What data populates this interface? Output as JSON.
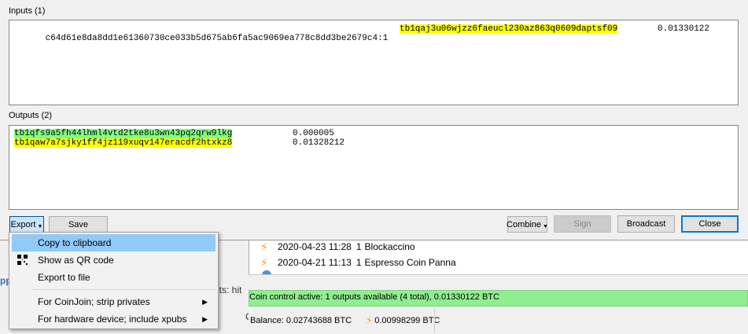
{
  "dialog": {
    "inputs_label": "Inputs (1)",
    "outputs_label": "Outputs (2)",
    "inputs": [
      {
        "outpoint": "c64d61e8da8dd1e61360730ce033b5d675ab6fa5ac9069ea778c8dd3be2679c4:1",
        "address": "tb1qaj3u06wjzz6faeucl230az863q0609daptsf09",
        "amount": "0.01330122",
        "highlight": "#ffff00"
      }
    ],
    "outputs": [
      {
        "address": "tb1qfs9a5fh44lhml4vtd2tke8u3wn43pq2qrw9lkg",
        "amount": "0.000005",
        "highlight": "#7fff7f"
      },
      {
        "address": "tb1qaw7a7sjky1ff4jz119xuqv147eracdf2htxkz8",
        "amount": "0.01328212",
        "highlight": "#ffff00"
      }
    ],
    "buttons": {
      "export": "Export",
      "save": "Save",
      "combine": "Combine",
      "sign": "Sign",
      "broadcast": "Broadcast",
      "close": "Close"
    }
  },
  "export_menu": {
    "items": [
      {
        "label": "Copy to clipboard"
      },
      {
        "label": "Show as QR code",
        "icon": "qr-code-icon"
      },
      {
        "label": "Export to file"
      },
      {
        "label": "For CoinJoin; strip privates"
      },
      {
        "label": "For hardware device; include xpubs"
      }
    ]
  },
  "background": {
    "left_fragment": "pp",
    "mid_fragment": "uts:  hit",
    "o_fragment": "O",
    "history": [
      {
        "date": "2020-04-23 11:28",
        "count": "1",
        "label": "Blockaccino"
      },
      {
        "date": "2020-04-21 11:13",
        "count": "1",
        "label": "Espresso Coin Panna"
      }
    ],
    "coin_control": "Coin control active: 1 outputs available (4 total), 0.01330122 BTC",
    "balance": "Balance: 0.02743688 BTC",
    "lightning_balance": "0.00998299 BTC"
  },
  "colors": {
    "input_highlight": "#ffff00",
    "change_highlight": "#ffff00",
    "recipient_highlight": "#7fff7f",
    "coin_control_bar": "#90ee90",
    "menu_active": "#91c9f7"
  }
}
